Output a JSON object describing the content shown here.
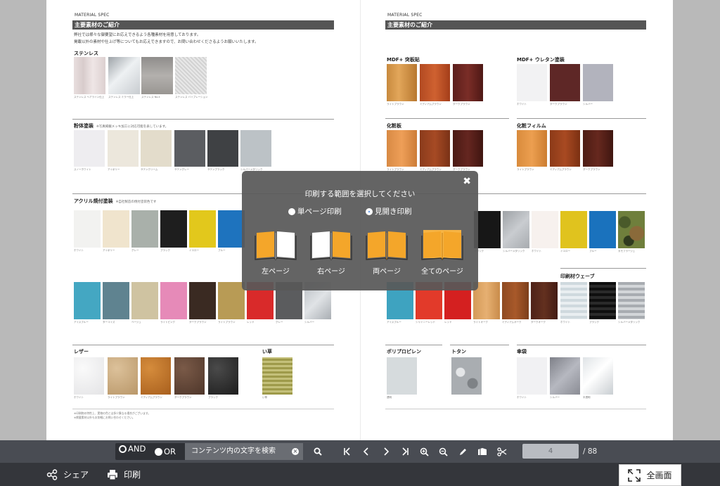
{
  "document": {
    "left_page": {
      "header": "MATERIAL SPEC",
      "title": "主要素材のご紹介",
      "intro_1": "弊社では様々な御要望にお応えできるよう各種素材を用意しております。",
      "intro_2": "掲載以外の素材や仕上げ等についてもお応えできますので、お問い合わせくださるようお願いいたします。",
      "section_stainless": "ステンレス",
      "section_powder": "粉体塗装",
      "section_powder_note": "※写真掲載メッキ加工に対応可能を表しています。",
      "section_acrylic": "アクリル焼付塗装",
      "section_acrylic_note": "※自社製造の焼付塗装色です",
      "section_leather": "レザー",
      "section_rush": "い草",
      "stainless_caps": [
        "ステンレス ヘアライン仕上",
        "ステンレス ミラー仕上",
        "ステンレス No.4",
        "ステンレス バイブレーション"
      ],
      "powder_caps": [
        "スノーホワイト",
        "アイボリー",
        "サテンクリーム",
        "サテングレー",
        "サテンブラック",
        "シルバーメタリック"
      ],
      "acrylic_row1_caps": [
        "ホワイト",
        "アイボリー",
        "グレー",
        "ブラック",
        "イエロー",
        "ブルー"
      ],
      "acrylic_row2_caps": [
        "アイスブルー",
        "ターコイズ",
        "ベージュ",
        "ライトピンク",
        "ダークブラウン",
        "ライトブラウン",
        "レッド",
        "グレー",
        "シルバー"
      ],
      "leather_caps": [
        "ホワイト",
        "ライトブラウン",
        "ミディアムブラウン",
        "ダークブラウン",
        "ブラック"
      ],
      "rush_caps": [
        "い草"
      ],
      "footnote_1": "※印刷物の特性上、実物の色とは多少異なる場合がございます。",
      "footnote_2": "※掲載素材以外もお気軽にお問い合わせください。"
    },
    "right_page": {
      "header": "MATERIAL SPEC",
      "title": "主要素材のご紹介",
      "section_mdf_veneer": "MDF+ 突板貼",
      "section_mdf_urethane": "MDF+ ウレタン塗装",
      "section_laminate": "化粧板",
      "section_decor_film": "化粧フィルム",
      "section_print_wave": "印刷材ウェーブ",
      "section_polypropylene": "ポリプロピレン",
      "section_tin": "トタン",
      "section_umbrella": "傘袋",
      "veneer_caps": [
        "ライトブラウン",
        "ミディアムブラウン",
        "ダークブラウン"
      ],
      "urethane_caps": [
        "ホワイト",
        "ダークブラウン",
        "シルバー"
      ],
      "laminate_caps": [
        "ライトブラウン",
        "ミディアムブラウン",
        "ダークブラウン"
      ],
      "film_caps": [
        "ライトブラウン",
        "ミディアムブラウン",
        "ダークブラウン"
      ],
      "mid_row_caps": [
        "ブラック",
        "シルバーメタリック",
        "ホワイト",
        "イエロー",
        "ブルー",
        "カモフラージュ"
      ],
      "low_row_caps": [
        "アイスブルー",
        "シャイニーレッド",
        "レッド",
        "ライトオーク",
        "ミディアムオーク",
        "ダークオーク",
        "ホワイト",
        "ブラック",
        "シルバーメタリック"
      ],
      "poly_caps": [
        "透明"
      ],
      "umbrella_caps": [
        "ホワイト",
        "シルバー",
        "半透明"
      ]
    }
  },
  "print_dialog": {
    "title": "印刷する範囲を選択してください",
    "radio_single": "単ページ印刷",
    "radio_spread": "見開き印刷",
    "selected": "見開き印刷",
    "close_icon": "close-icon",
    "options": [
      {
        "label": "左ページ",
        "icon": "book-left-icon"
      },
      {
        "label": "右ページ",
        "icon": "book-right-icon"
      },
      {
        "label": "両ページ",
        "icon": "book-both-icon"
      },
      {
        "label": "全てのページ",
        "icon": "book-all-icon"
      }
    ],
    "accent_color": "#f4a62a"
  },
  "toolbar": {
    "and_label": "AND",
    "or_label": "OR",
    "search_placeholder": "コンテンツ内の文字を検索",
    "current_page": "4",
    "total_pages": "/ 88"
  },
  "bottom_bar": {
    "share_label": "シェア",
    "print_label": "印刷",
    "fullscreen_label": "全画面"
  },
  "colors": {
    "toolbar_bg": "#494c53",
    "bottom_bar_bg": "#34363b",
    "viewer_bg": "#b9b9b9",
    "title_bar": "#555555"
  }
}
